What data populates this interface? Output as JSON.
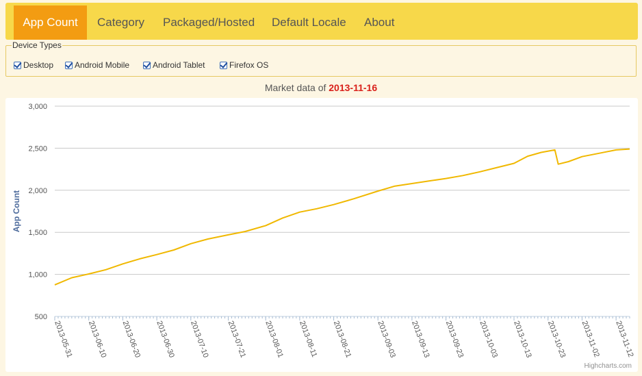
{
  "nav": {
    "tabs": [
      {
        "label": "App Count",
        "active": true
      },
      {
        "label": "Category",
        "active": false
      },
      {
        "label": "Packaged/Hosted",
        "active": false
      },
      {
        "label": "Default Locale",
        "active": false
      },
      {
        "label": "About",
        "active": false
      }
    ]
  },
  "device_types": {
    "legend": "Device Types",
    "options": [
      {
        "label": "Desktop",
        "checked": true
      },
      {
        "label": "Android Mobile",
        "checked": true
      },
      {
        "label": "Android Tablet",
        "checked": true
      },
      {
        "label": "Firefox OS",
        "checked": true
      }
    ]
  },
  "market": {
    "prefix": "Market data of",
    "date": "2013-11-16"
  },
  "credits": "Highcharts.com",
  "colors": {
    "nav_bg": "#f7d84a",
    "active_tab": "#f39c12",
    "line": "#f0b800",
    "date_text": "#d9211b",
    "axis_title": "#4d6b9c"
  },
  "chart_data": {
    "type": "line",
    "title": "",
    "xlabel": "",
    "ylabel": "App Count",
    "ylim": [
      500,
      3000
    ],
    "yticks": [
      "3,000",
      "2,500",
      "2,000",
      "1,500",
      "1,000",
      "500"
    ],
    "xticks": [
      "2013-05-31",
      "2013-06-10",
      "2013-06-20",
      "2013-06-30",
      "2013-07-10",
      "2013-07-21",
      "2013-08-01",
      "2013-08-11",
      "2013-08-21",
      "2013-09-03",
      "2013-09-13",
      "2013-09-23",
      "2013-10-03",
      "2013-10-13",
      "2013-10-23",
      "2013-11-02",
      "2013-11-12"
    ],
    "grid": true,
    "series": [
      {
        "x": [
          "2013-05-31",
          "2013-06-05",
          "2013-06-10",
          "2013-06-15",
          "2013-06-20",
          "2013-06-25",
          "2013-06-30",
          "2013-07-05",
          "2013-07-10",
          "2013-07-15",
          "2013-07-21",
          "2013-07-26",
          "2013-08-01",
          "2013-08-06",
          "2013-08-11",
          "2013-08-16",
          "2013-08-21",
          "2013-08-27",
          "2013-09-03",
          "2013-09-08",
          "2013-09-13",
          "2013-09-18",
          "2013-09-23",
          "2013-09-28",
          "2013-10-03",
          "2013-10-08",
          "2013-10-13",
          "2013-10-17",
          "2013-10-21",
          "2013-10-25",
          "2013-10-26",
          "2013-10-29",
          "2013-11-02",
          "2013-11-07",
          "2013-11-12",
          "2013-11-16"
        ],
        "values": [
          875,
          960,
          1005,
          1055,
          1125,
          1185,
          1235,
          1290,
          1365,
          1420,
          1470,
          1510,
          1580,
          1670,
          1740,
          1780,
          1830,
          1900,
          1990,
          2050,
          2080,
          2110,
          2140,
          2175,
          2220,
          2270,
          2320,
          2405,
          2450,
          2480,
          2310,
          2340,
          2400,
          2440,
          2480,
          2490
        ]
      }
    ]
  }
}
